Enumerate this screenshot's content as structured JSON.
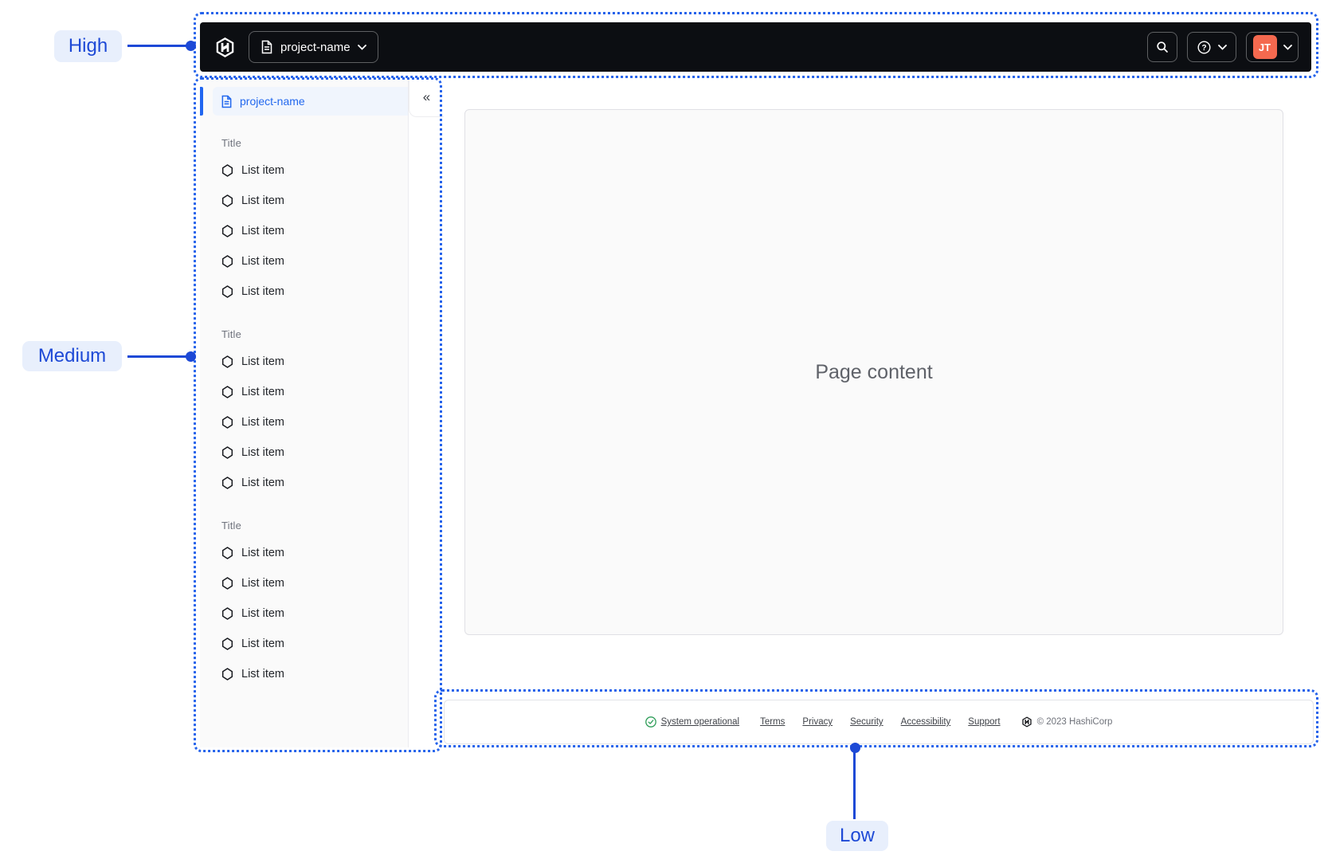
{
  "annotations": {
    "high": {
      "label": "High"
    },
    "medium": {
      "label": "Medium"
    },
    "low": {
      "label": "Low"
    }
  },
  "navbar": {
    "project_switcher_label": "project-name",
    "search_icon": "magnifier",
    "help_icon": "?",
    "user_initials": "JT"
  },
  "sidebar": {
    "project_label": "project-name",
    "collapse_icon": "«",
    "sections": [
      {
        "title": "Title",
        "items": [
          "List item",
          "List item",
          "List item",
          "List item",
          "List item"
        ]
      },
      {
        "title": "Title",
        "items": [
          "List item",
          "List item",
          "List item",
          "List item",
          "List item"
        ]
      },
      {
        "title": "Title",
        "items": [
          "List item",
          "List item",
          "List item",
          "List item",
          "List item"
        ]
      }
    ]
  },
  "main": {
    "placeholder": "Page content"
  },
  "footer": {
    "status_label": "System operational",
    "links": [
      "Terms",
      "Privacy",
      "Security",
      "Accessibility",
      "Support"
    ],
    "copyright": "© 2023 HashiCorp"
  },
  "colors": {
    "annotation_blue": "#1d49d6",
    "annotation_border": "#2563eb",
    "annotation_bg": "#e8effc",
    "navbar_bg": "#0c0e12",
    "avatar_orange": "#f4694f",
    "active_blue": "#2268ee",
    "status_green": "#2e9d58",
    "panel_gray": "#fafafa"
  }
}
